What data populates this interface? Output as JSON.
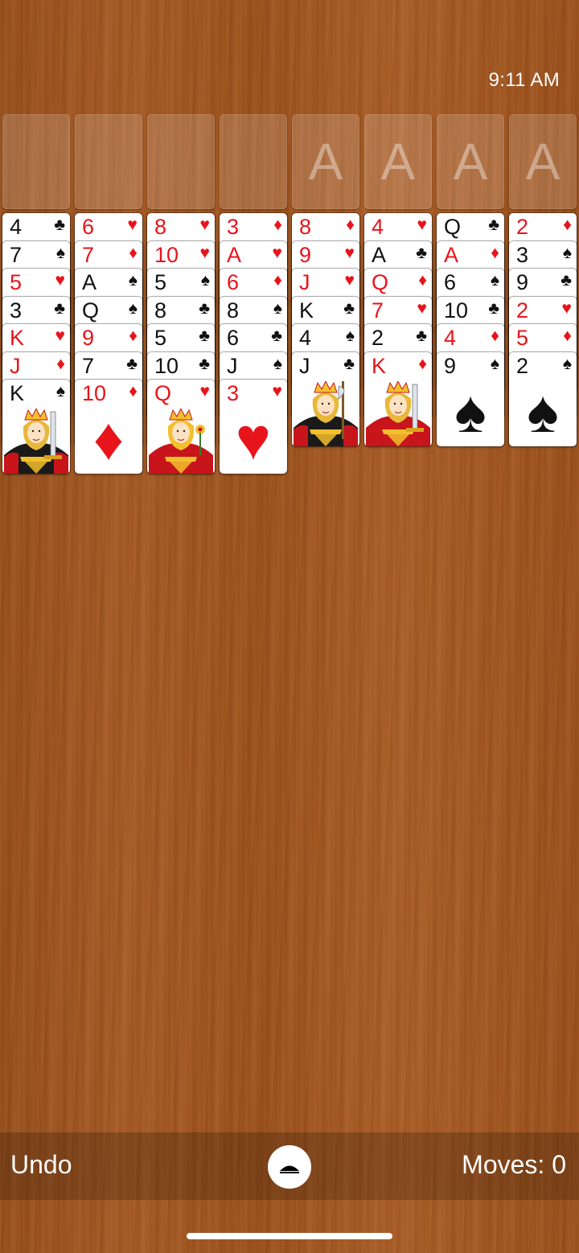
{
  "status": {
    "time": "9:11 AM"
  },
  "free_cells": [
    "",
    "",
    "",
    ""
  ],
  "foundations": [
    "A",
    "A",
    "A",
    "A"
  ],
  "tableau": [
    [
      {
        "r": "4",
        "s": "♣"
      },
      {
        "r": "7",
        "s": "♠"
      },
      {
        "r": "5",
        "s": "♥"
      },
      {
        "r": "3",
        "s": "♣"
      },
      {
        "r": "K",
        "s": "♥"
      },
      {
        "r": "J",
        "s": "♦"
      },
      {
        "r": "K",
        "s": "♠"
      }
    ],
    [
      {
        "r": "6",
        "s": "♥"
      },
      {
        "r": "7",
        "s": "♦"
      },
      {
        "r": "A",
        "s": "♠"
      },
      {
        "r": "Q",
        "s": "♠"
      },
      {
        "r": "9",
        "s": "♦"
      },
      {
        "r": "7",
        "s": "♣"
      },
      {
        "r": "10",
        "s": "♦"
      }
    ],
    [
      {
        "r": "8",
        "s": "♥"
      },
      {
        "r": "10",
        "s": "♥"
      },
      {
        "r": "5",
        "s": "♠"
      },
      {
        "r": "8",
        "s": "♣"
      },
      {
        "r": "5",
        "s": "♣"
      },
      {
        "r": "10",
        "s": "♣"
      },
      {
        "r": "Q",
        "s": "♥"
      }
    ],
    [
      {
        "r": "3",
        "s": "♦"
      },
      {
        "r": "A",
        "s": "♥"
      },
      {
        "r": "6",
        "s": "♦"
      },
      {
        "r": "8",
        "s": "♠"
      },
      {
        "r": "6",
        "s": "♣"
      },
      {
        "r": "J",
        "s": "♠"
      },
      {
        "r": "3",
        "s": "♥"
      }
    ],
    [
      {
        "r": "8",
        "s": "♦"
      },
      {
        "r": "9",
        "s": "♥"
      },
      {
        "r": "J",
        "s": "♥"
      },
      {
        "r": "K",
        "s": "♣"
      },
      {
        "r": "4",
        "s": "♠"
      },
      {
        "r": "J",
        "s": "♣"
      }
    ],
    [
      {
        "r": "4",
        "s": "♥"
      },
      {
        "r": "A",
        "s": "♣"
      },
      {
        "r": "Q",
        "s": "♦"
      },
      {
        "r": "7",
        "s": "♥"
      },
      {
        "r": "2",
        "s": "♣"
      },
      {
        "r": "K",
        "s": "♦"
      }
    ],
    [
      {
        "r": "Q",
        "s": "♣"
      },
      {
        "r": "A",
        "s": "♦"
      },
      {
        "r": "6",
        "s": "♠"
      },
      {
        "r": "10",
        "s": "♣"
      },
      {
        "r": "4",
        "s": "♦"
      },
      {
        "r": "9",
        "s": "♠"
      }
    ],
    [
      {
        "r": "2",
        "s": "♦"
      },
      {
        "r": "3",
        "s": "♠"
      },
      {
        "r": "9",
        "s": "♣"
      },
      {
        "r": "2",
        "s": "♥"
      },
      {
        "r": "5",
        "s": "♦"
      },
      {
        "r": "2",
        "s": "♠"
      }
    ]
  ],
  "bottom_bar": {
    "undo_label": "Undo",
    "moves_label": "Moves: 0",
    "menu_icon": "chevron-up-icon"
  },
  "colors": {
    "red_suit": "#e8141b",
    "black_suit": "#111111",
    "table": "#a3551e"
  }
}
